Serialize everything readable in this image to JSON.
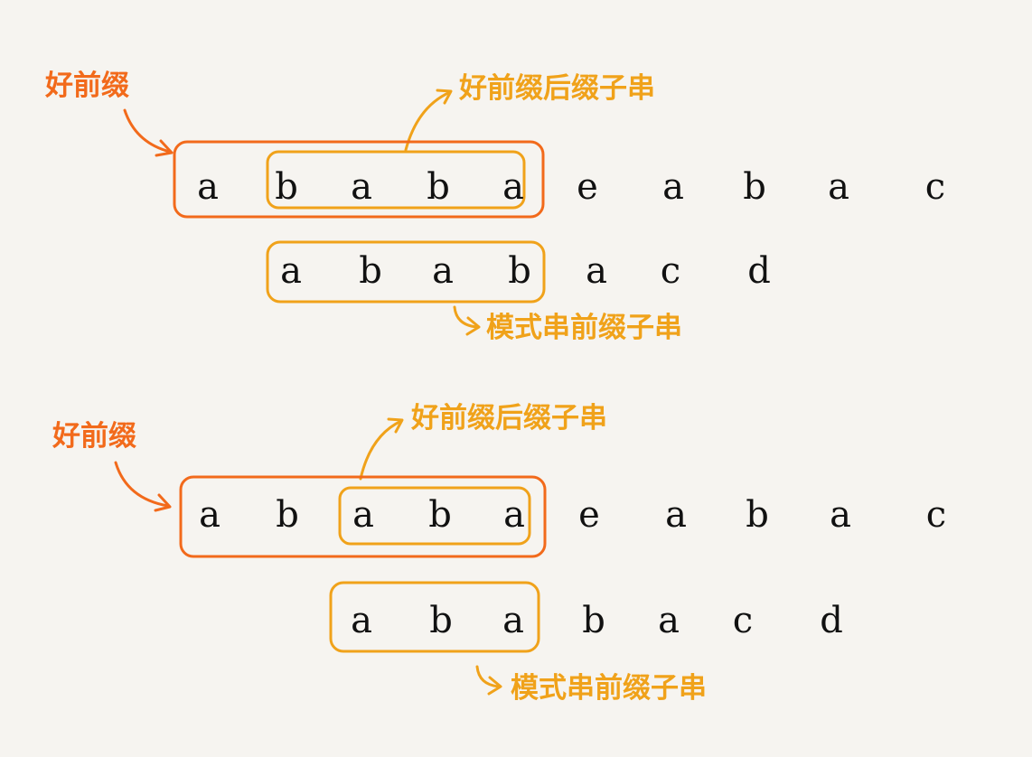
{
  "colors": {
    "background": "#f6f4f0",
    "good_prefix": "#f26a1b",
    "substring": "#f0a21a",
    "text": "#111111"
  },
  "labels": {
    "good_prefix": "好前缀",
    "good_prefix_suffix_substring": "好前缀后缀子串",
    "pattern_prefix_substring": "模式串前缀子串"
  },
  "diagrams": [
    {
      "main_string": [
        "a",
        "b",
        "a",
        "b",
        "a",
        "e",
        "a",
        "b",
        "a",
        "c"
      ],
      "pattern": [
        "a",
        "b",
        "a",
        "b",
        "a",
        "c",
        "d"
      ],
      "good_prefix_length": 5,
      "suffix_substring_length": 4,
      "pattern_shift": 1
    },
    {
      "main_string": [
        "a",
        "b",
        "a",
        "b",
        "a",
        "e",
        "a",
        "b",
        "a",
        "c"
      ],
      "pattern": [
        "a",
        "b",
        "a",
        "b",
        "a",
        "c",
        "d"
      ],
      "good_prefix_length": 5,
      "suffix_substring_length": 3,
      "pattern_shift": 2
    }
  ]
}
